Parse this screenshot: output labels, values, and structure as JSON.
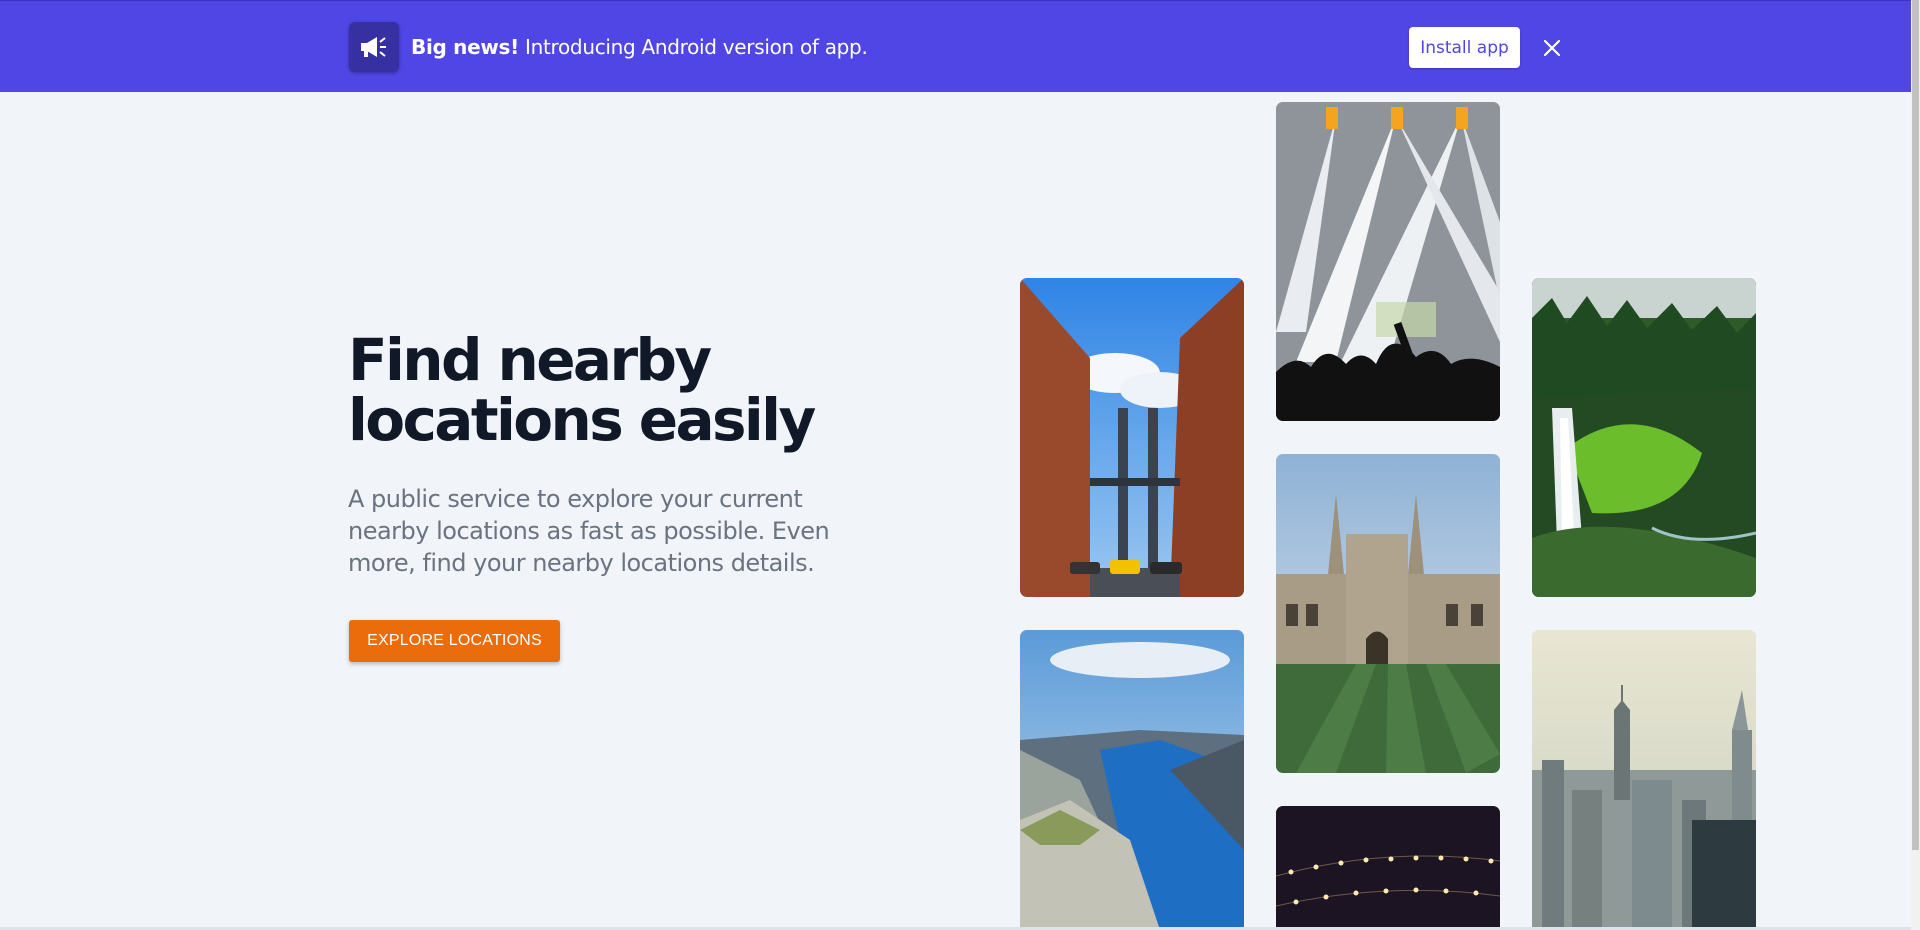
{
  "banner": {
    "icon": "megaphone-icon",
    "headline": "Big news!",
    "message": "Introducing Android version of app.",
    "install_label": "Install app",
    "close_icon": "close-icon",
    "background_color": "#4f46e5"
  },
  "hero": {
    "title_line1": "Find nearby",
    "title_line2": "locations easily",
    "subtitle": "A public service to explore your current nearby locations as fast as possible. Even more, find your nearby locations details.",
    "cta_label": "EXPLORE LOCATIONS",
    "cta_color": "#ea6c0a"
  },
  "gallery": {
    "images": [
      "city-bridge-street-photo",
      "concert-lights-photo",
      "waterfall-forest-photo",
      "fjord-cliff-photo",
      "gothic-college-lawn-photo",
      "city-skyline-photo",
      "night-string-lights-photo"
    ]
  }
}
